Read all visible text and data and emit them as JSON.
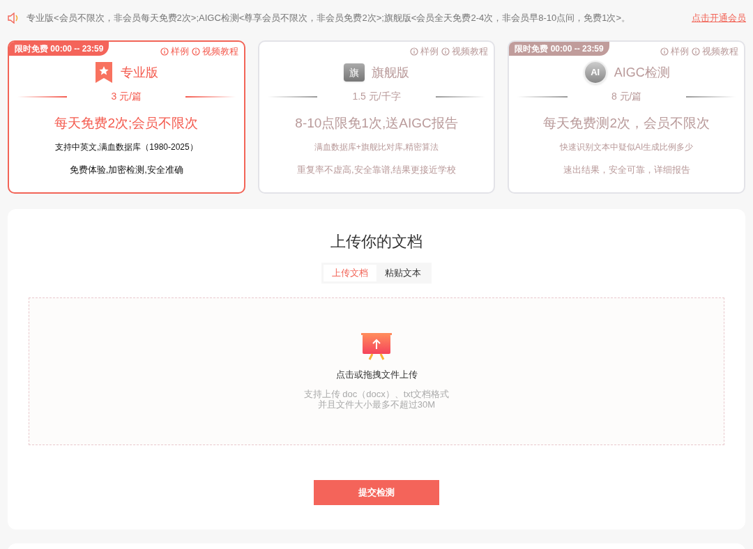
{
  "notice": {
    "text": "专业版<会员不限次，非会员每天免费2次>;AIGC检测<尊享会员不限次，非会员免费2次>;旗舰版<会员全天免费2-4次，非会员早8-10点间，免费1次>。",
    "link": "点击开通会员"
  },
  "plans": [
    {
      "kind": "ribbon",
      "selected": true,
      "badge": "限时免费 00:00 -- 23:59",
      "links": [
        "样例",
        "视频教程"
      ],
      "name": "专业版",
      "price": "3 元/篇",
      "headline": "每天免费2次;会员不限次",
      "feature": "支持中英文,满血数据库（1980-2025）",
      "note": "免费体验,加密检测,安全准确"
    },
    {
      "kind": "flag",
      "selected": false,
      "links": [
        "样例",
        "视频教程"
      ],
      "icon_text": "旗",
      "name": "旗舰版",
      "price": "1.5 元/千字",
      "headline": "8-10点限免1次,送AIGC报告",
      "feature": "满血数据库+旗舰比对库,精密算法",
      "note": "重复率不虚高,安全靠谱,结果更接近学校"
    },
    {
      "kind": "ai",
      "selected": false,
      "badge": "限时免费 00:00 -- 23:59",
      "links": [
        "样例",
        "视频教程"
      ],
      "icon_text": "AI",
      "name": "AIGC检测",
      "price": "8 元/篇",
      "headline": "每天免费测2次，会员不限次",
      "feature": "快速识别文本中疑似AI生成比例多少",
      "note": "速出结果，安全可靠，详细报告"
    }
  ],
  "upload": {
    "title": "上传你的文档",
    "tabs": [
      {
        "label": "上传文档",
        "selected": true
      },
      {
        "label": "粘贴文本",
        "selected": false
      }
    ],
    "drop_label": "点击或拖拽文件上传",
    "hints": [
      "支持上传 doc（docx）、txt文档格式",
      "并且文件大小最多不超过30M"
    ],
    "submit": "提交检测"
  }
}
